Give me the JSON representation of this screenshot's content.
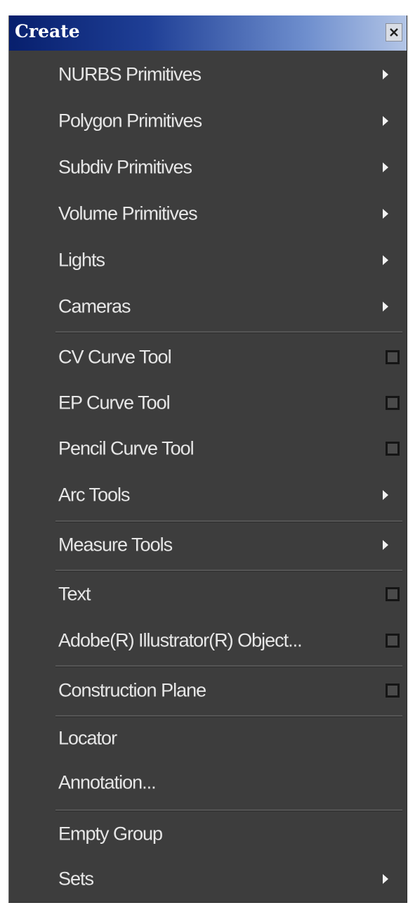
{
  "window": {
    "title": "Create",
    "close_icon": "close-icon"
  },
  "menu": {
    "items": [
      {
        "label": "NURBS Primitives",
        "indicator": "submenu-arrow"
      },
      {
        "label": "Polygon Primitives",
        "indicator": "submenu-arrow"
      },
      {
        "label": "Subdiv Primitives",
        "indicator": "submenu-arrow"
      },
      {
        "label": "Volume Primitives",
        "indicator": "submenu-arrow"
      },
      {
        "label": "Lights",
        "indicator": "submenu-arrow"
      },
      {
        "label": "Cameras",
        "indicator": "submenu-arrow"
      },
      {
        "label": "CV Curve Tool",
        "indicator": "option-box"
      },
      {
        "label": "EP Curve Tool",
        "indicator": "option-box"
      },
      {
        "label": "Pencil Curve Tool",
        "indicator": "option-box"
      },
      {
        "label": "Arc Tools",
        "indicator": "submenu-arrow"
      },
      {
        "label": "Measure Tools",
        "indicator": "submenu-arrow"
      },
      {
        "label": "Text",
        "indicator": "option-box"
      },
      {
        "label": "Adobe(R) Illustrator(R) Object...",
        "indicator": "option-box"
      },
      {
        "label": "Construction Plane",
        "indicator": "option-box"
      },
      {
        "label": "Locator",
        "indicator": "none"
      },
      {
        "label": "Annotation...",
        "indicator": "none"
      },
      {
        "label": "Empty Group",
        "indicator": "none"
      },
      {
        "label": "Sets",
        "indicator": "submenu-arrow"
      }
    ]
  },
  "colors": {
    "menu_background": "#3d3d3d",
    "title_gradient_start": "#071f6d",
    "title_gradient_end": "#b3c5e6",
    "text": "#e6e6e6"
  }
}
